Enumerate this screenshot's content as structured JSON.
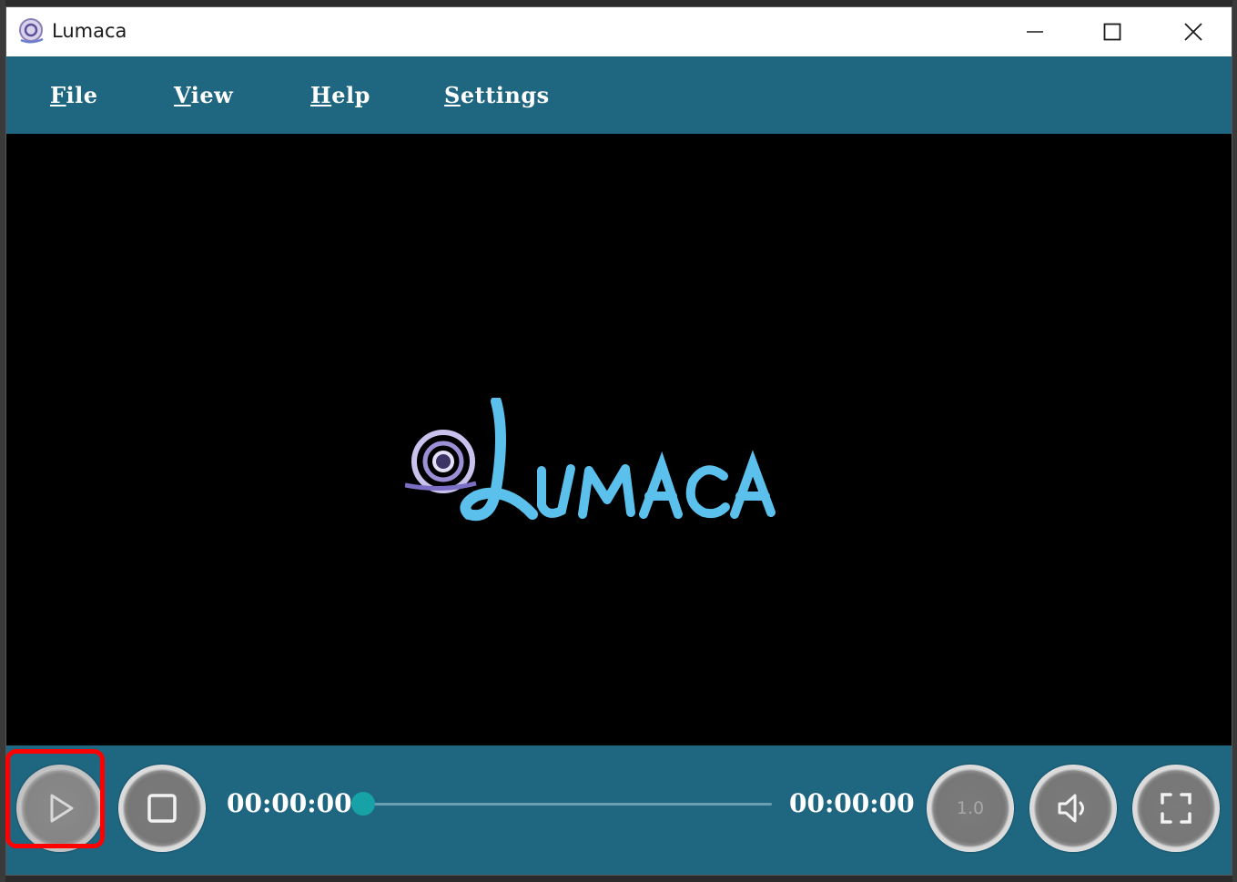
{
  "window": {
    "title": "Lumaca",
    "controls": [
      "minimize-icon",
      "maximize-icon",
      "close-icon"
    ]
  },
  "menu": {
    "items": [
      {
        "label": "File",
        "mnemonic": "F",
        "rest": "ile"
      },
      {
        "label": "View",
        "mnemonic": "V",
        "rest": "iew"
      },
      {
        "label": "Help",
        "mnemonic": "H",
        "rest": "elp"
      },
      {
        "label": "Settings",
        "mnemonic": "S",
        "rest": "ettings"
      }
    ]
  },
  "video": {
    "logo_text": "@Lumaca"
  },
  "controls": {
    "play_icon": "play-icon",
    "stop_icon": "stop-icon",
    "current_time": "00:00:00",
    "total_time": "00:00:00",
    "seek_progress": 0,
    "speed": "1.0",
    "volume_icon": "volume-icon",
    "fullscreen_icon": "fullscreen-icon"
  },
  "colors": {
    "accent": "#1f6680",
    "seek_thumb": "#17a2a8",
    "logo": "#5bc0eb",
    "highlight": "#ff0000"
  }
}
